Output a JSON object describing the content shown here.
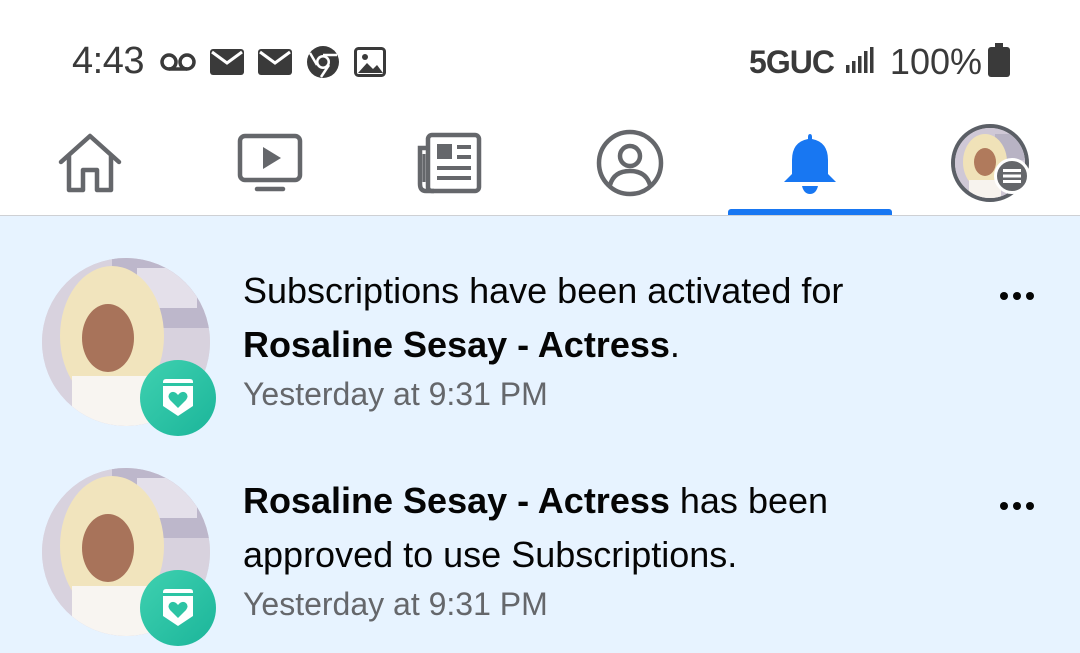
{
  "status_bar": {
    "time": "4:43",
    "network": "5GUC",
    "battery": "100%",
    "left_icons": [
      "voicemail-icon",
      "mail-icon",
      "mail-icon",
      "chrome-icon",
      "image-icon"
    ]
  },
  "nav": {
    "items": [
      "home-icon",
      "video-icon",
      "news-icon",
      "profile-icon",
      "notifications-icon",
      "menu-avatar"
    ],
    "active": "notifications",
    "accent": "#1877f2"
  },
  "notifications": [
    {
      "text_before": "Subscriptions have been activated for ",
      "bold": "Rosaline Sesay - Actress",
      "text_after": ".",
      "time": "Yesterday at 9:31 PM"
    },
    {
      "text_before": "",
      "bold": "Rosaline Sesay - Actress",
      "text_after": " has been approved to use Subscriptions.",
      "time": "Yesterday at 9:31 PM"
    }
  ],
  "colors": {
    "unread_background": "#e7f3ff",
    "badge": "#2cc4a4",
    "secondary_text": "#65676b"
  }
}
